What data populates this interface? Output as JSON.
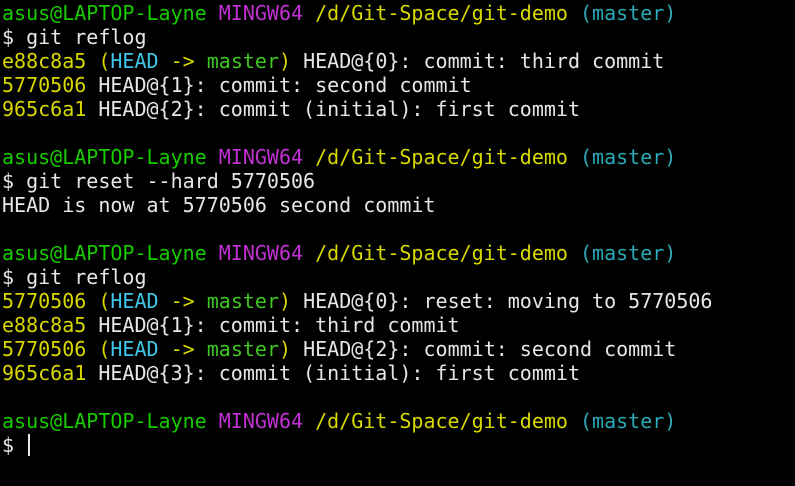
{
  "colors": {
    "background": "#000000",
    "text": "#e6e6e6",
    "user_host": "#19cb00",
    "mingw": "#c132d3",
    "path_hash": "#d8d800",
    "branch": "#2aa9b7",
    "head_ref": "#3ec6e8",
    "master_ref": "#3ec822"
  },
  "prompt": {
    "user_host": "asus@LAPTOP-Layne",
    "env": "MINGW64",
    "path": "/d/Git-Space/git-demo",
    "branch": "(master)"
  },
  "session1": {
    "command": "$ git reflog",
    "rows": [
      {
        "hash": "e88c8a5",
        "ref_open": "(",
        "head": "HEAD",
        "arrow": " -> ",
        "master": "master",
        "ref_close": ")",
        "text": " HEAD@{0}: commit: third commit"
      },
      {
        "hash": "5770506",
        "text": " HEAD@{1}: commit: second commit"
      },
      {
        "hash": "965c6a1",
        "text": " HEAD@{2}: commit (initial): first commit"
      }
    ]
  },
  "session2": {
    "command": "$ git reset --hard 5770506",
    "output": "HEAD is now at 5770506 second commit"
  },
  "session3": {
    "command": "$ git reflog",
    "rows": [
      {
        "hash": "5770506",
        "ref_open": "(",
        "head": "HEAD",
        "arrow": " -> ",
        "master": "master",
        "ref_close": ")",
        "text": " HEAD@{0}: reset: moving to 5770506"
      },
      {
        "hash": "e88c8a5",
        "text": " HEAD@{1}: commit: third commit"
      },
      {
        "hash": "5770506",
        "ref_open": "(",
        "head": "HEAD",
        "arrow": " -> ",
        "master": "master",
        "ref_close": ")",
        "text": " HEAD@{2}: commit: second commit"
      },
      {
        "hash": "965c6a1",
        "text": " HEAD@{3}: commit (initial): first commit"
      }
    ]
  },
  "final": {
    "prompt_symbol": "$ "
  }
}
